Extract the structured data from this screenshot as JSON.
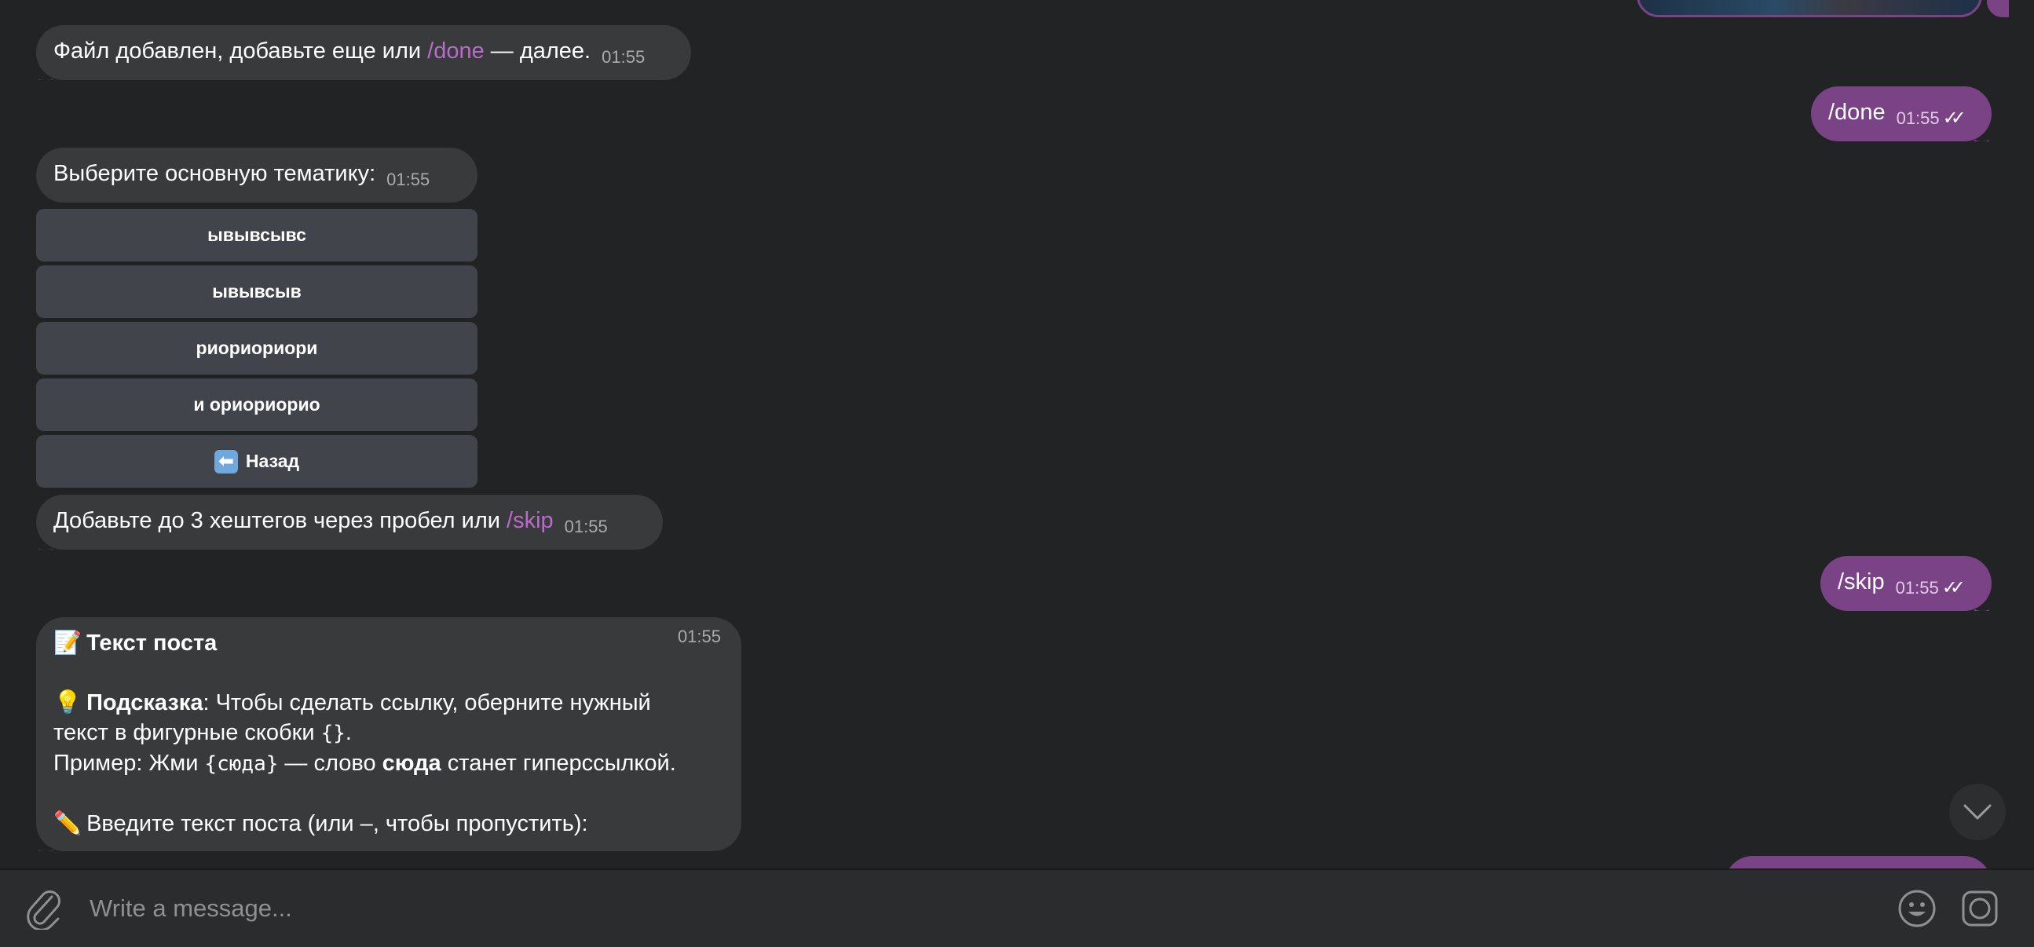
{
  "messages": {
    "file_added": {
      "text": "Файл добавлен, добавьте еще или ",
      "cmd": "/done",
      "suffix": " — далее.",
      "time": "01:55"
    },
    "done_out": {
      "text": "/done",
      "time": "01:55",
      "status": "read"
    },
    "choose_theme": {
      "text": "Выберите основную тематику:",
      "time": "01:55"
    },
    "keyboard": [
      {
        "label": "ывывсывс"
      },
      {
        "label": "ывывсыв"
      },
      {
        "label": "риориориори"
      },
      {
        "label": "и ориориорио"
      },
      {
        "label": "Назад",
        "icon": "left-arrow-icon"
      }
    ],
    "hashtags": {
      "text": "Добавьте до 3 хештегов через пробел или ",
      "cmd": "/skip",
      "time": "01:55"
    },
    "skip_out": {
      "text": "/skip",
      "time": "01:55",
      "status": "read"
    },
    "post": {
      "title_emoji": "📝",
      "title": "Текст поста",
      "hint_emoji": "💡",
      "hint_bold": "Подсказка",
      "hint_text": ": Чтобы сделать ссылку, оберните нужный",
      "hint_text2": "текст в фигурные скобки ",
      "braces": "{}",
      "hint_end": ".",
      "example_prefix": "Пример: Жми ",
      "example_code": "{сюда}",
      "example_mid": " — слово ",
      "example_bold": "сюда",
      "example_end": " станет гиперссылкой.",
      "prompt_emoji": "✏️",
      "prompt": "Введите текст поста (или –, чтобы пропустить):",
      "time": "01:55"
    }
  },
  "composer": {
    "placeholder": "Write a message..."
  },
  "colors": {
    "background": "#222324",
    "incoming_bubble": "#393a3b",
    "outgoing_bubble": "#7a4385",
    "command_link": "#b86cc9",
    "keyboard_button": "#41454b"
  }
}
